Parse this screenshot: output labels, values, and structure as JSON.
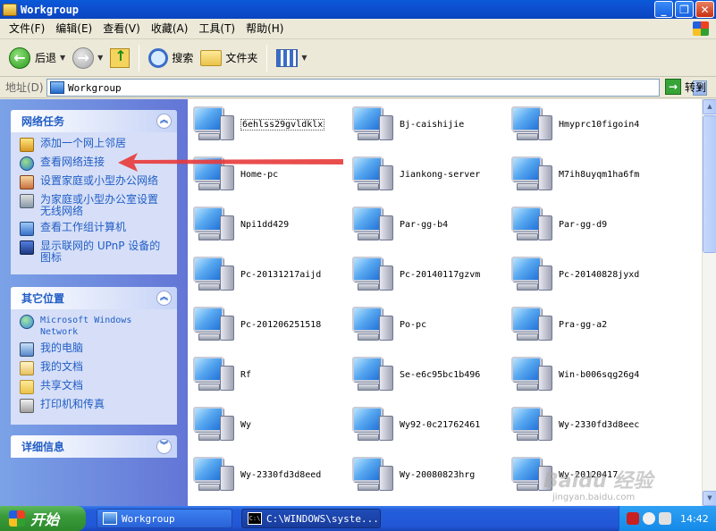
{
  "window": {
    "title": "Workgroup"
  },
  "menu": [
    "文件(F)",
    "编辑(E)",
    "查看(V)",
    "收藏(A)",
    "工具(T)",
    "帮助(H)"
  ],
  "toolbar": {
    "back": "后退",
    "search": "搜索",
    "folders": "文件夹"
  },
  "address": {
    "label": "地址(D)",
    "value": "Workgroup",
    "go": "转到"
  },
  "network_tasks": {
    "title": "网络任务",
    "items": [
      "添加一个网上邻居",
      "查看网络连接",
      "设置家庭或小型办公网络",
      "为家庭或小型办公室设置无线网络",
      "查看工作组计算机",
      "显示联网的 UPnP 设备的图标"
    ]
  },
  "other_places": {
    "title": "其它位置",
    "items": [
      "Microsoft Windows Network",
      "我的电脑",
      "我的文档",
      "共享文档",
      "打印机和传真"
    ]
  },
  "details": {
    "title": "详细信息"
  },
  "computers": [
    "6ehlss29gvldklx",
    "Bj-caishijie",
    "Hmyprc10figoin4",
    "Home-pc",
    "Jiankong-server",
    "M7ih8uyqm1ha6fm",
    "Npi1dd429",
    "Par-gg-b4",
    "Par-gg-d9",
    "Pc-20131217aijd",
    "Pc-20140117gzvm",
    "Pc-20140828jyxd",
    "Pc-201206251518",
    "Po-pc",
    "Pra-gg-a2",
    "Rf",
    "Se-e6c95bc1b496",
    "Win-b006sqg26g4",
    "Wy",
    "Wy92-0c21762461",
    "Wy-2330fd3d8eec",
    "Wy-2330fd3d8eed",
    "Wy-20080823hrg",
    "Wy-20120417"
  ],
  "taskbar": {
    "start": "开始",
    "task1": "Workgroup",
    "task2": "C:\\WINDOWS\\syste...",
    "clock": "14:42"
  },
  "watermark": {
    "brand": "Baidu 经验",
    "site": "jingyan.baidu.com"
  },
  "colors": {
    "titlebar": "#0b50cc",
    "task_link": "#215dc6",
    "annotation_arrow": "#e83a3a"
  }
}
